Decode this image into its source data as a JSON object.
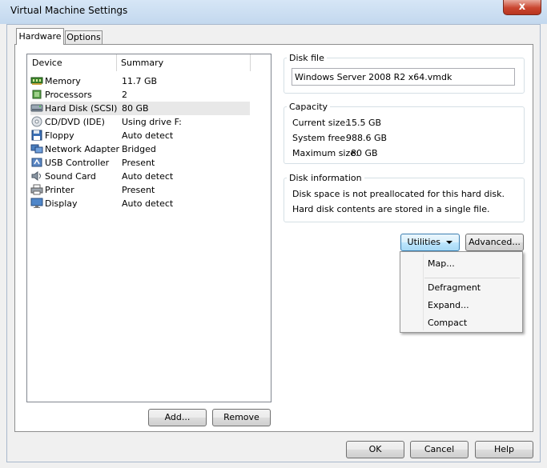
{
  "window": {
    "title": "Virtual Machine Settings",
    "close_label": "x"
  },
  "tabs": [
    {
      "label": "Hardware"
    },
    {
      "label": "Options"
    }
  ],
  "device_list": {
    "columns": [
      "Device",
      "Summary"
    ],
    "rows": [
      {
        "device": "Memory",
        "summary": "11.7 GB",
        "icon": "memory-icon"
      },
      {
        "device": "Processors",
        "summary": "2",
        "icon": "processor-icon"
      },
      {
        "device": "Hard Disk (SCSI)",
        "summary": "80 GB",
        "icon": "hard-disk-icon",
        "selected": true
      },
      {
        "device": "CD/DVD (IDE)",
        "summary": "Using drive F:",
        "icon": "cd-dvd-icon"
      },
      {
        "device": "Floppy",
        "summary": "Auto detect",
        "icon": "floppy-icon"
      },
      {
        "device": "Network Adapter",
        "summary": "Bridged",
        "icon": "network-adapter-icon"
      },
      {
        "device": "USB Controller",
        "summary": "Present",
        "icon": "usb-controller-icon"
      },
      {
        "device": "Sound Card",
        "summary": "Auto detect",
        "icon": "sound-card-icon"
      },
      {
        "device": "Printer",
        "summary": "Present",
        "icon": "printer-icon"
      },
      {
        "device": "Display",
        "summary": "Auto detect",
        "icon": "display-icon"
      }
    ]
  },
  "list_buttons": {
    "add": "Add...",
    "remove": "Remove"
  },
  "disk_file": {
    "label": "Disk file",
    "value": "Windows Server 2008 R2 x64.vmdk"
  },
  "capacity": {
    "label": "Capacity",
    "current_label": "Current size:",
    "current_value": "15.5 GB",
    "free_label": "System free:",
    "free_value": "988.6 GB",
    "max_label": "Maximum size:",
    "max_value": "80 GB"
  },
  "disk_info": {
    "label": "Disk information",
    "line1": "Disk space is not preallocated for this hard disk.",
    "line2": "Hard disk contents are stored in a single file."
  },
  "disk_buttons": {
    "utilities": "Utilities",
    "advanced": "Advanced..."
  },
  "utilities_menu": [
    "Map...",
    "Defragment",
    "Expand...",
    "Compact"
  ],
  "footer": {
    "ok": "OK",
    "cancel": "Cancel",
    "help": "Help"
  }
}
